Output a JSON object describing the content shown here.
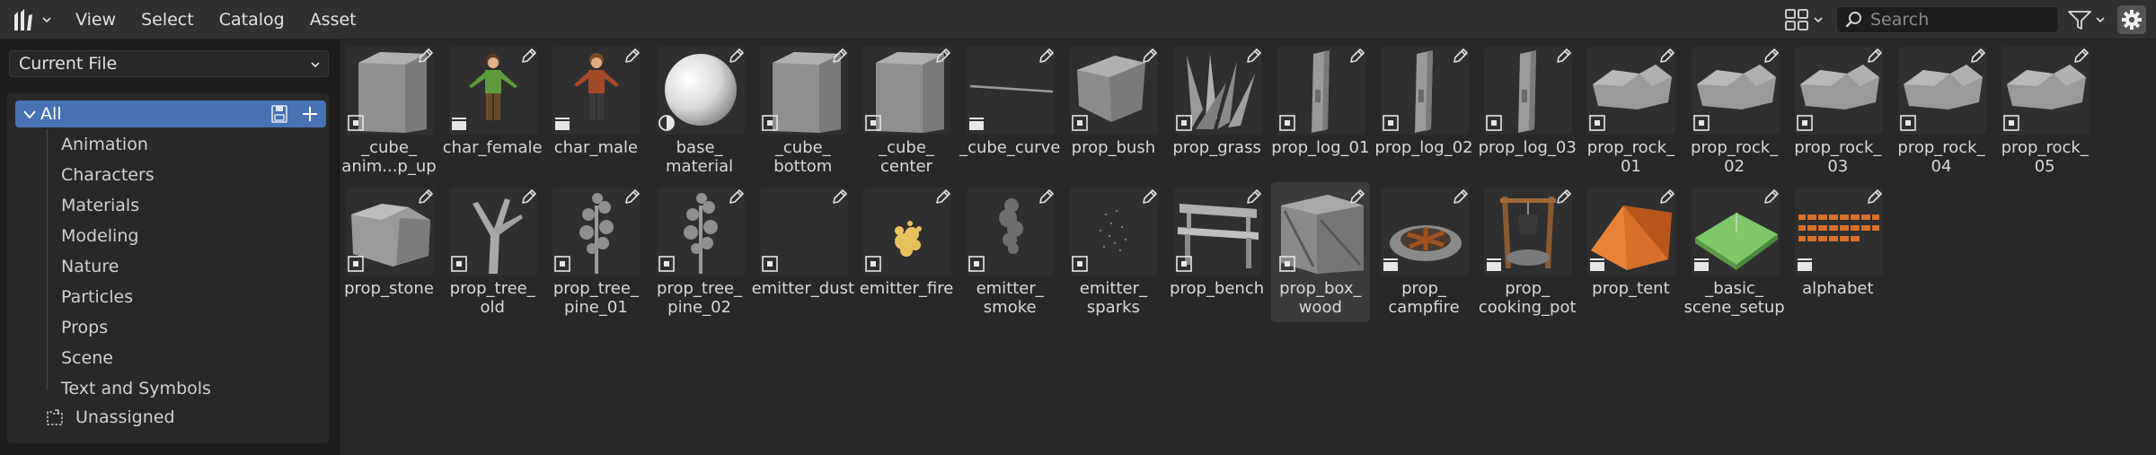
{
  "header": {
    "menus": [
      "View",
      "Select",
      "Catalog",
      "Asset"
    ],
    "search_placeholder": "Search"
  },
  "sidebar": {
    "library": "Current File",
    "catalog_all": "All",
    "catalogs": [
      "Animation",
      "Characters",
      "Materials",
      "Modeling",
      "Nature",
      "Particles",
      "Props",
      "Scene",
      "Text and Symbols"
    ],
    "unassigned": "Unassigned"
  },
  "assets": [
    {
      "label": "_cube_\nanim...p_up",
      "type": "cube"
    },
    {
      "label": "char_female",
      "type": "char_female"
    },
    {
      "label": "char_male",
      "type": "char_male"
    },
    {
      "label": "base_\nmaterial",
      "type": "sphere"
    },
    {
      "label": "_cube_\nbottom",
      "type": "cube"
    },
    {
      "label": "_cube_\ncenter",
      "type": "cube"
    },
    {
      "label": "_cube_curve",
      "type": "curve"
    },
    {
      "label": "prop_bush",
      "type": "bush"
    },
    {
      "label": "prop_grass",
      "type": "grass"
    },
    {
      "label": "prop_log_01",
      "type": "log"
    },
    {
      "label": "prop_log_02",
      "type": "log"
    },
    {
      "label": "prop_log_03",
      "type": "log"
    },
    {
      "label": "prop_rock_\n01",
      "type": "rock"
    },
    {
      "label": "prop_rock_\n02",
      "type": "rock"
    },
    {
      "label": "prop_rock_\n03",
      "type": "rock"
    },
    {
      "label": "prop_rock_\n04",
      "type": "rock"
    },
    {
      "label": "prop_rock_\n05",
      "type": "rock"
    },
    {
      "label": "prop_stone",
      "type": "stone"
    },
    {
      "label": "prop_tree_\nold",
      "type": "tree_old"
    },
    {
      "label": "prop_tree_\npine_01",
      "type": "pine"
    },
    {
      "label": "prop_tree_\npine_02",
      "type": "pine"
    },
    {
      "label": "emitter_dust",
      "type": "dust"
    },
    {
      "label": "emitter_fire",
      "type": "fire"
    },
    {
      "label": "emitter_\nsmoke",
      "type": "smoke"
    },
    {
      "label": "emitter_\nsparks",
      "type": "sparks"
    },
    {
      "label": "prop_bench",
      "type": "bench"
    },
    {
      "label": "prop_box_\nwood",
      "type": "box"
    },
    {
      "label": "prop_\ncampfire",
      "type": "campfire"
    },
    {
      "label": "prop_\ncooking_pot",
      "type": "pot"
    },
    {
      "label": "prop_tent",
      "type": "tent"
    },
    {
      "label": "_basic_\nscene_setup",
      "type": "scene"
    },
    {
      "label": "alphabet",
      "type": "alphabet"
    }
  ],
  "selected_asset": "prop_box_\nwood",
  "colors": {
    "accent": "#4772b3",
    "panel": "#282828",
    "header": "#303030",
    "background": "#1d1d1d"
  }
}
